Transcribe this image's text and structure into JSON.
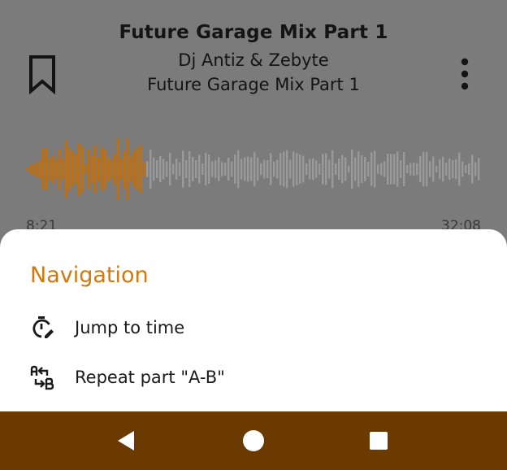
{
  "player": {
    "title": "Future Garage Mix Part 1",
    "artist": "Dj Antiz & Zebyte",
    "album": "Future Garage Mix Part 1",
    "elapsed": "8:21",
    "duration": "32:08",
    "progress_fraction": 0.26
  },
  "sheet": {
    "heading": "Navigation",
    "items": [
      {
        "label": "Jump to time",
        "icon": "timer-edit-icon"
      },
      {
        "label": "Repeat part \"A-B\"",
        "icon": "ab-repeat-icon"
      }
    ]
  },
  "navbar": {
    "icons": [
      "back-triangle-icon",
      "home-circle-icon",
      "recents-square-icon"
    ]
  },
  "colors": {
    "accent": "#d2780c",
    "played_wave": "#c46e0a",
    "unplayed_wave": "#9a9a9a",
    "scrim_background": "#7b7b7b",
    "nav_bar": "#6b3a00"
  }
}
